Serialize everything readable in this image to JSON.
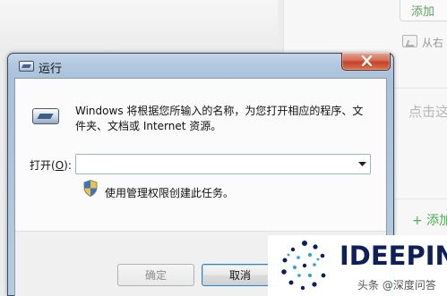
{
  "background": {
    "top_button": "添加",
    "from_label": "从右",
    "click_hint": "点击这",
    "add_label": "+ 添加"
  },
  "dialog": {
    "title": "运行",
    "description": "Windows 将根据您所输入的名称，为您打开相应的程序、文件夹、文档或 Internet 资源。",
    "open_label_prefix": "打开(",
    "open_label_key": "O",
    "open_label_suffix": "):",
    "input_value": "",
    "admin_note": "使用管理权限创建此任务。",
    "ok_label": "确定",
    "cancel_label": "取消"
  },
  "watermark": {
    "name": "IDEEPIN",
    "caption": "头条 @深度问答"
  },
  "icons": {
    "title": "run-icon",
    "program": "run-icon",
    "uac": "shield-icon",
    "close": "close-icon",
    "dropdown": "chevron-down-icon"
  },
  "colors": {
    "close_button": "#c5412a",
    "title_bar": "#b1c8e0",
    "watermark_text": "#0f1f5c",
    "accent_green": "#4caf50"
  }
}
